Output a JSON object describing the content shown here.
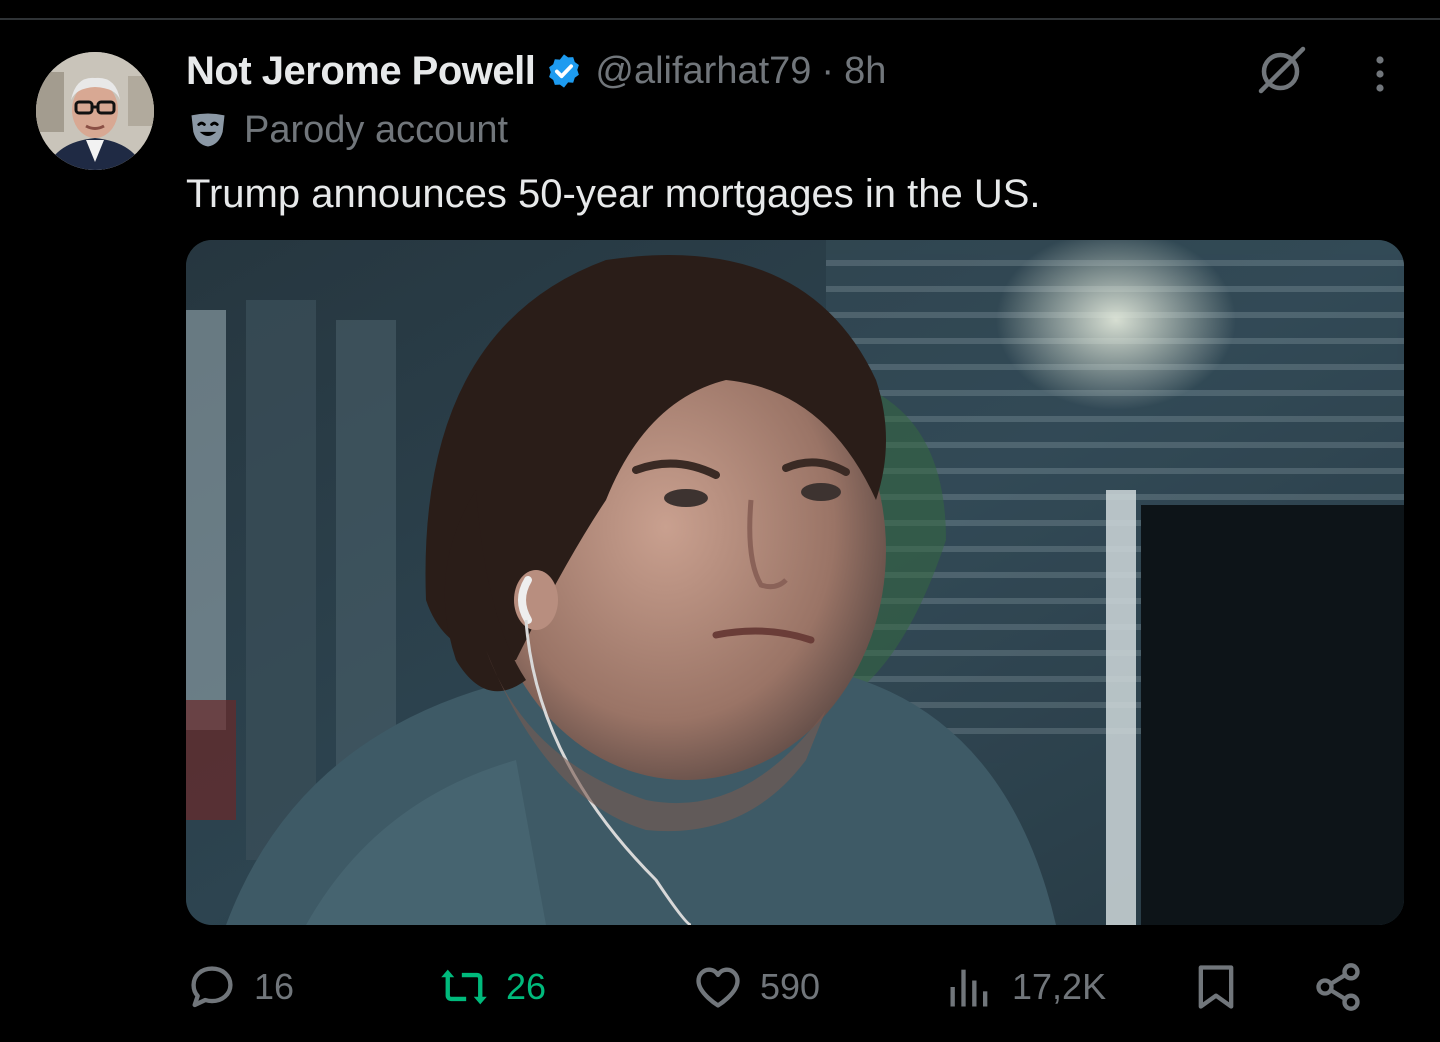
{
  "tweet": {
    "display_name": "Not Jerome Powell",
    "handle": "@alifarhat79",
    "separator": "·",
    "time": "8h",
    "parody_label": "Parody account",
    "text": "Trump announces 50-year mortgages in the US."
  },
  "actions": {
    "replies": "16",
    "retweets": "26",
    "likes": "590",
    "views": "17,2K"
  },
  "colors": {
    "background": "#000000",
    "primary_text": "#e7e9ea",
    "secondary_text": "#71767b",
    "verified_blue": "#1d9bf0",
    "retweet_green": "#00ba7c"
  },
  "icons": {
    "verified": "verified-badge-icon",
    "parody": "theater-mask-icon",
    "grok": "grok-icon",
    "more": "more-vertical-icon",
    "reply": "reply-icon",
    "retweet": "retweet-icon",
    "like": "heart-icon",
    "views": "views-icon",
    "bookmark": "bookmark-icon",
    "share": "share-icon"
  }
}
